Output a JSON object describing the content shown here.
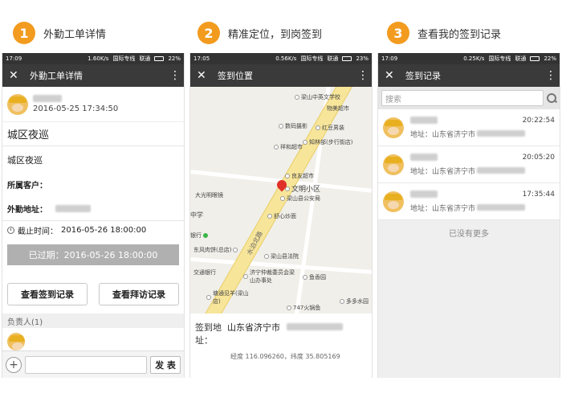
{
  "steps": [
    {
      "num": "1",
      "title": "外勤工单详情"
    },
    {
      "num": "2",
      "title": "精准定位，到岗签到"
    },
    {
      "num": "3",
      "title": "查看我的签到记录"
    }
  ],
  "phones": [
    {
      "status_time": "17:09",
      "speed": "1.60K/s",
      "net": "国际专线",
      "carrier": "联通",
      "battery": "22%"
    },
    {
      "status_time": "17:05",
      "speed": "0.56K/s",
      "net": "国际专线",
      "carrier": "联通",
      "battery": "23%"
    },
    {
      "status_time": "17:09",
      "speed": "0.25K/s",
      "net": "国际专线",
      "carrier": "联通",
      "battery": "22%"
    }
  ],
  "detail": {
    "appbar_title": "外勤工单详情",
    "created_time": "2016-05-25 17:34:50",
    "title": "城区夜巡",
    "content": "城区夜巡",
    "customer_label": "所属客户：",
    "address_label": "外勤地址：",
    "deadline_label": "截止时间：",
    "deadline_value": "2016-05-26 18:00:00",
    "expired_text": "已过期：2016-05-26 18:00:00",
    "btn_checkin_records": "查看签到记录",
    "btn_visit_records": "查看拜访记录",
    "section_owner": "负责人(1)",
    "send_label": "发 表"
  },
  "location": {
    "appbar_title": "签到位置",
    "address_label": "签到地址：",
    "address_value": "山东省济宁市",
    "coords": "经度 116.096260，纬度 35.805169",
    "map_pois": [
      "梁山中英文学校",
      "物美超市",
      "数码摄影",
      "红豆男装",
      "祥和超市",
      "知林部(步行街店)",
      "良友超市",
      "文明小区",
      "梁山县公安局",
      "舒心炒面",
      "大光明眼镜",
      "中学",
      "银行",
      "东风肉饼(总店)",
      "梁山县法院",
      "济宁仲裁委员会梁山办事处",
      "鱼香园",
      "交通银行",
      "塘通见羊(梁山店)",
      "747火锅鱼",
      "多多水园"
    ],
    "street_name": "水泊北路"
  },
  "records": {
    "appbar_title": "签到记录",
    "search_placeholder": "搜索",
    "items": [
      {
        "time": "20:22:54",
        "address_prefix": "地址：山东省济宁市"
      },
      {
        "time": "20:05:20",
        "address_prefix": "地址：山东省济宁市"
      },
      {
        "time": "17:35:44",
        "address_prefix": "地址：山东省济宁市"
      }
    ],
    "no_more": "已没有更多"
  }
}
